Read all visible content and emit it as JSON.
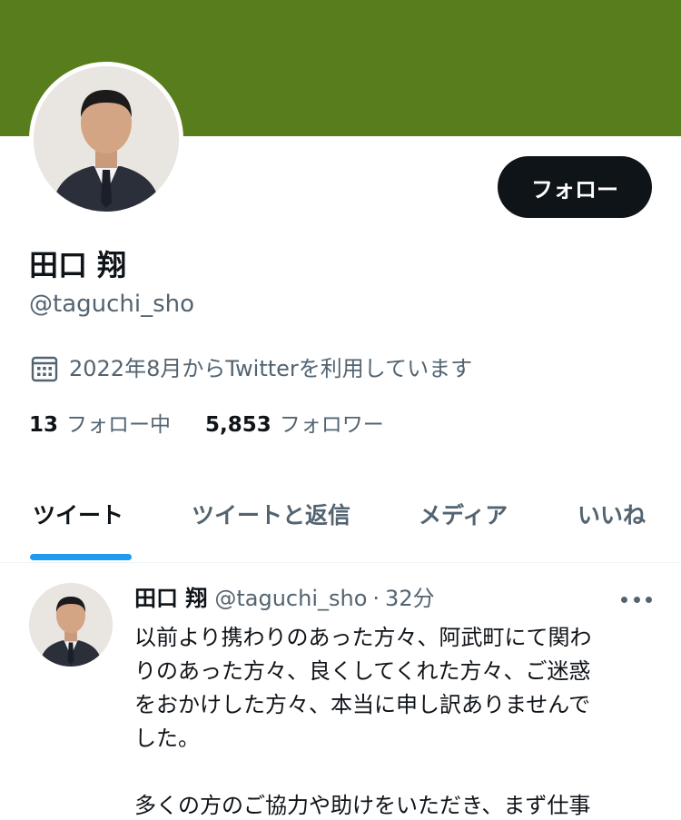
{
  "profile": {
    "banner_color": "#587d1c",
    "display_name": "田口 翔",
    "handle": "@taguchi_sho",
    "joined": "2022年8月からTwitterを利用しています",
    "follow_label": "フォロー",
    "following_count": "13",
    "following_label": "フォロー中",
    "followers_count": "5,853",
    "followers_label": "フォロワー"
  },
  "tabs": [
    {
      "label": "ツイート",
      "active": true
    },
    {
      "label": "ツイートと返信",
      "active": false
    },
    {
      "label": "メディア",
      "active": false
    },
    {
      "label": "いいね",
      "active": false
    }
  ],
  "tweet": {
    "author": "田口 翔",
    "handle": "@taguchi_sho",
    "separator": "·",
    "time": "32分",
    "lines": [
      "以前より携わりのあった方々、阿武町にて関わ",
      "りのあった方々、良くしてくれた方々、ご迷惑",
      "をおかけした方々、本当に申し訳ありませんで",
      "した。",
      "",
      "多くの方のご協力や助けをいただき、まず仕事"
    ]
  },
  "icons": {
    "calendar": "calendar-icon",
    "more": "more-icon"
  },
  "colors": {
    "accent": "#1d9bf0",
    "text": "#0f1419",
    "secondary": "#536471"
  }
}
